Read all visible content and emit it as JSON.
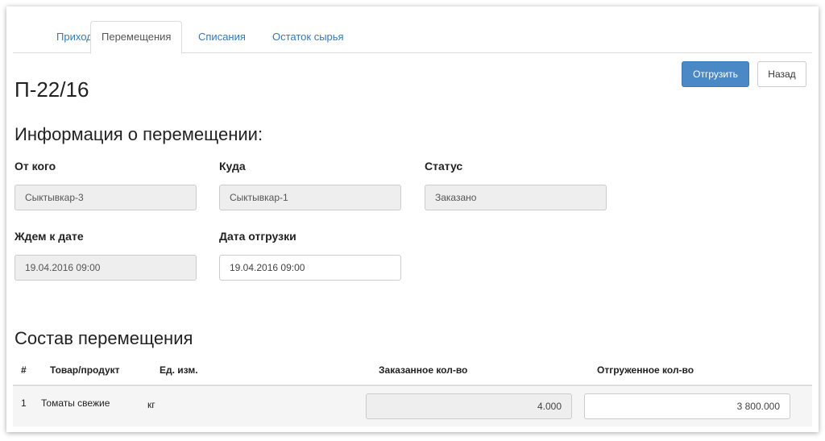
{
  "tabs": [
    {
      "label": "Приходы"
    },
    {
      "label": "Перемещения",
      "active": true
    },
    {
      "label": "Списания"
    },
    {
      "label": "Остаток сырья"
    }
  ],
  "toolbar": {
    "ship_label": "Отгрузить",
    "back_label": "Назад"
  },
  "document": {
    "number": "П-22/16"
  },
  "info": {
    "title": "Информация о перемещении:",
    "from_label": "От кого",
    "from_value": "Сыктывкар-3",
    "to_label": "Куда",
    "to_value": "Сыктывкар-1",
    "status_label": "Статус",
    "status_value": "Заказано",
    "expected_label": "Ждем к дате",
    "expected_value": "19.04.2016 09:00",
    "ship_date_label": "Дата отгрузки",
    "ship_date_value": "19.04.2016 09:00"
  },
  "composition": {
    "title": "Состав перемещения",
    "columns": [
      "#",
      "Товар/продукт",
      "Ед. изм.",
      "Заказанное кол-во",
      "Отгруженное кол-во"
    ],
    "rows": [
      {
        "num": "1",
        "product": "Томаты свежие",
        "unit": "кг",
        "ordered": "4.000",
        "shipped": "3 800.000"
      }
    ]
  },
  "colors": {
    "accent": "#4a88c6",
    "link": "#337ab7",
    "readonly_bg": "#eeeeee"
  }
}
